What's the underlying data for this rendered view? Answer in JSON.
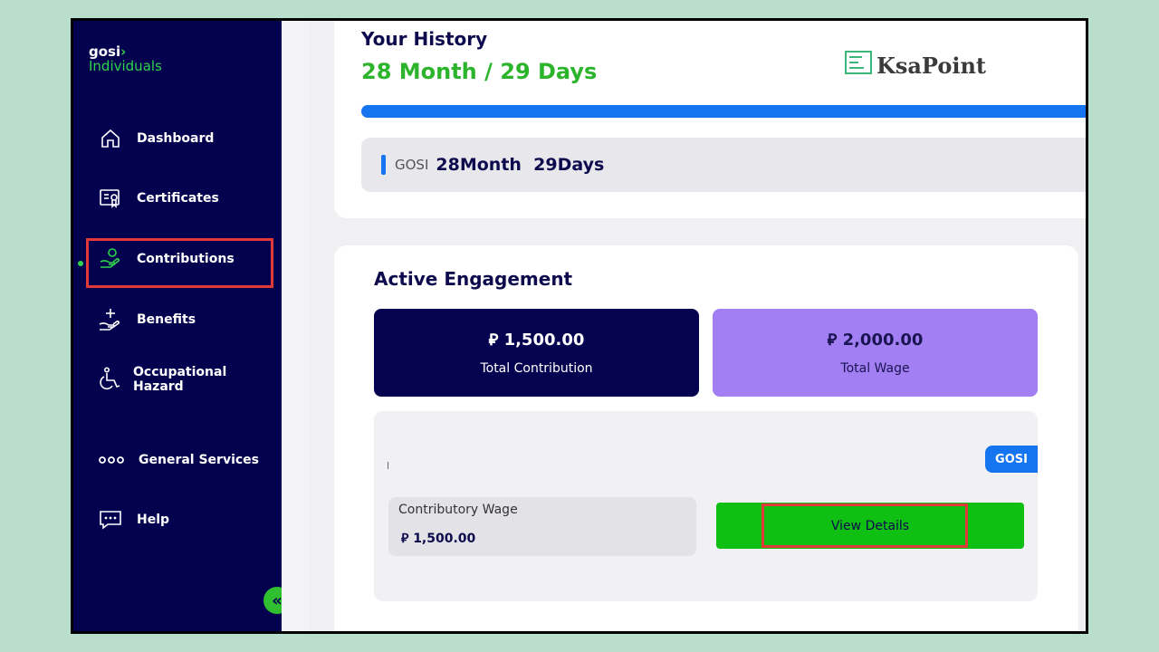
{
  "brand": {
    "top": "gosi",
    "chevron": "›",
    "bottom": "Individuals"
  },
  "nav": [
    {
      "label": "Dashboard",
      "icon": "home-icon"
    },
    {
      "label": "Certificates",
      "icon": "certificate-icon"
    },
    {
      "label": "Contributions",
      "icon": "hand-coin-icon",
      "active": true
    },
    {
      "label": "Benefits",
      "icon": "hand-plus-icon"
    },
    {
      "label": "Occupational Hazard",
      "line1": "Occupational",
      "line2": "Hazard",
      "icon": "wheelchair-icon"
    },
    {
      "label": "General Services",
      "icon": "dots-icon"
    },
    {
      "label": "Help",
      "icon": "chat-icon"
    }
  ],
  "collapse": {
    "glyph": "«"
  },
  "history": {
    "title": "Your History",
    "value": "28 Month / 29 Days"
  },
  "watermark": {
    "text": "KsaPoint"
  },
  "progress": {
    "value": 1.0
  },
  "gosi_row": {
    "tag": "GOSI",
    "value": "28Month  29Days"
  },
  "engagement": {
    "title": "Active Engagement",
    "total_contribution": {
      "value": "⃁ 1,500.00",
      "label": "Total Contribution"
    },
    "total_wage": {
      "value": "⃁ 2,000.00",
      "label": "Total Wage"
    },
    "badge": "GOSI",
    "contributory_wage": {
      "label": "Contributory Wage",
      "value": "⃁ 1,500.00"
    },
    "view_details": "View Details"
  },
  "colors": {
    "sidebar": "#04024f",
    "accent_green": "#2cb52c",
    "primary_blue": "#1574f0",
    "purple": "#a27ff2",
    "highlight_red": "#e23a3a"
  }
}
